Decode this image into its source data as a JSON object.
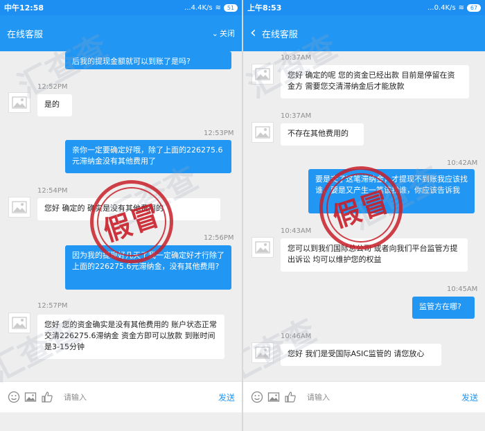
{
  "left": {
    "status_time": "中午12:58",
    "status_net": "...4.4K/s",
    "status_battery": "51",
    "header_title": "在线客服",
    "close_label": "关闭",
    "messages": [
      {
        "dir": "out",
        "text": "后我的提现金额就可以到账了是吗?"
      },
      {
        "ts": "12:52PM",
        "dir": "in",
        "text": "是的"
      },
      {
        "ts": "12:53PM",
        "dir": "out",
        "text": "亲你一定要确定好哦，除了上面的226275.6元滞纳金没有其他费用了"
      },
      {
        "ts": "12:54PM",
        "dir": "in",
        "text": "您好 确定的 确实是没有其他费用的"
      },
      {
        "ts": "12:56PM",
        "dir": "out",
        "text": "因为我的提现好几天了我一定确定好才行除了上面的226275.6元滞纳金，没有其他费用?"
      },
      {
        "ts": "12:57PM",
        "dir": "in",
        "text": "您好 您的资金确实是没有其他费用的 账户状态正常 交清226275.6滞纳金 资金方即可以放款 到账时间是3-15分钟"
      }
    ],
    "input_placeholder": "请输入",
    "send_label": "发送"
  },
  "right": {
    "status_time": "上午8:53",
    "status_net": "...0.4K/s",
    "status_battery": "67",
    "header_title": "在线客服",
    "messages": [
      {
        "ts": "10:37AM",
        "dir": "in",
        "text": "您好 确定的呢 您的资金已经出款 目前是停留在资金方 需要您交清滞纳金后才能放款"
      },
      {
        "ts": "10:37AM",
        "dir": "in",
        "text": "不存在其他费用的"
      },
      {
        "ts": "10:42AM",
        "dir": "out",
        "text": "要是交了这笔滞纳金，才提现不到账我应该找谁，要是又产生一笔该找谁，你应该告诉我"
      },
      {
        "ts": "10:43AM",
        "dir": "in",
        "text": "您可以到我们国际总公司 或者向我们平台监管方提出诉讼 均可以维护您的权益"
      },
      {
        "ts": "10:45AM",
        "dir": "out",
        "text": "监管方在哪?"
      },
      {
        "ts": "10:46AM",
        "dir": "in",
        "text": "您好 我们是受国际ASIC监管的 请您放心"
      }
    ],
    "input_placeholder": "请输入",
    "send_label": "发送"
  },
  "stamp_text": "假冒",
  "watermark_text": "汇查查",
  "colors": {
    "header": "#2196f3",
    "outgoing": "#2196f3",
    "incoming": "#ffffff",
    "stamp": "#c81e28"
  }
}
